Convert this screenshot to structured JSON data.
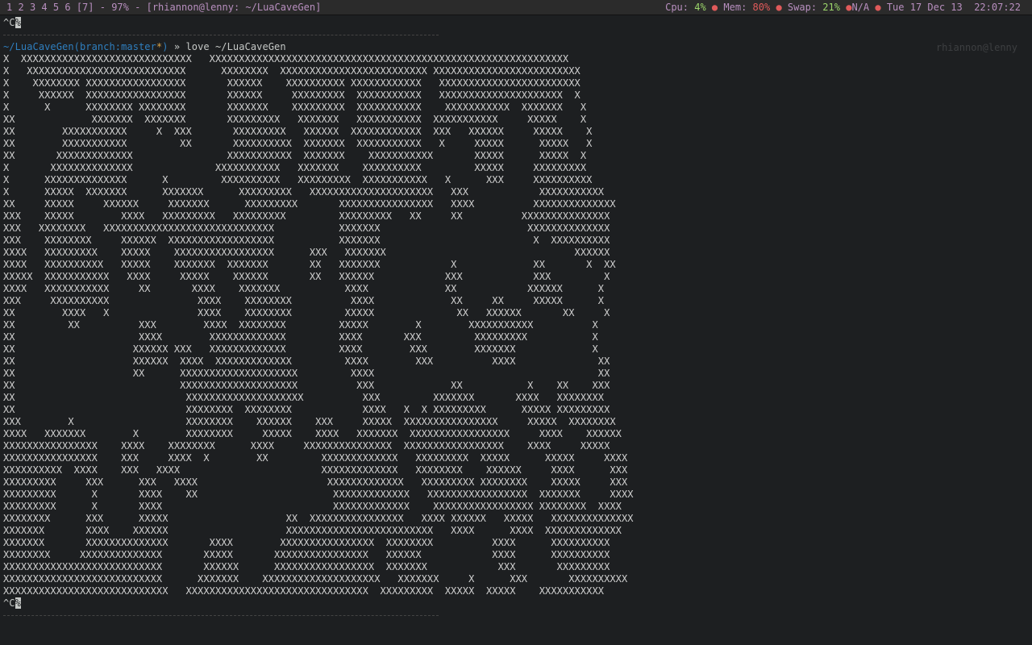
{
  "statusbar": {
    "workspaces": [
      "1",
      "2",
      "3",
      "4",
      "5",
      "6",
      "[7]"
    ],
    "zoom": "97%",
    "window_title": "[rhiannon@lenny: ~/LuaCaveGen]",
    "cpu_label": "Cpu:",
    "cpu_value": "4%",
    "mem_label": "Mem:",
    "mem_value": "80%",
    "swap_label": "Swap:",
    "swap_value": "21%",
    "battery": "N/A",
    "date": "Tue 17 Dec 13",
    "time": "22:07:22"
  },
  "terminal": {
    "interrupt_top": "^C",
    "cursor_char": "%",
    "prompt_path": "~/LuaCaveGen",
    "prompt_branch_open": "(branch:",
    "prompt_branch": "master",
    "prompt_dirty": "*",
    "prompt_branch_close": ")",
    "prompt_arrow": "»",
    "command": "love ~/LuaCaveGen",
    "hostname": "rhiannon@lenny",
    "interrupt_bottom": "^C",
    "cave_lines": [
      "X  XXXXXXXXXXXXXXXXXXXXXXXXXXXXX   XXXXXXXXXXXXXXXXXXXXXXXXXXXXXXXXXXXXXXXXXXXXXXXXXXXXXXXXXXXXX",
      "X   XXXXXXXXXXXXXXXXXXXXXXXXXXX      XXXXXXXX  XXXXXXXXXXXXXXXXXXXXXXXXX XXXXXXXXXXXXXXXXXXXXXXXXX",
      "X    XXXXXXXX XXXXXXXXXXXXXXXXX       XXXXXX    XXXXXXXXXX XXXXXXXXXXXX   XXXXXXXXXXXXXXXXXXXXXXXX",
      "X     XXXXXX  XXXXXXXXXXXXXXXXX       XXXXXX     XXXXXXXXX  XXXXXXXXXXX   XXXXXXXXXXXXXXXXXXXXX  X",
      "X      X      XXXXXXXX XXXXXXXX       XXXXXXX    XXXXXXXXX  XXXXXXXXXXX    XXXXXXXXXXX  XXXXXXX   X",
      "XX             XXXXXXX  XXXXXXX       XXXXXXXXX   XXXXXXX   XXXXXXXXXXX  XXXXXXXXXXX     XXXXX    X",
      "XX        XXXXXXXXXXX     X  XXX       XXXXXXXXX   XXXXXX  XXXXXXXXXXXX  XXX   XXXXXX     XXXXX    X",
      "XX        XXXXXXXXXXX         XX       XXXXXXXXXX  XXXXXXX  XXXXXXXXXXX   X     XXXXX      XXXXX   X",
      "XX       XXXXXXXXXXXXX                XXXXXXXXXXX  XXXXXXX    XXXXXXXXXXX       XXXXX      XXXXX  X",
      "X       XXXXXXXXXXXXXX              XXXXXXXXXXX   XXXXXXX    XXXXXXXXXX         XXXXX     XXXXXXXXX",
      "X      XXXXXXXXXXXXXX      X         XXXXXXXXXX   XXXXXXXXX  XXXXXXXXXXX   X      XXX     XXXXXXXXXX",
      "X      XXXXX  XXXXXXX      XXXXXXX      XXXXXXXXX   XXXXXXXXXXXXXXXXXXXXX   XXX            XXXXXXXXXXX",
      "XX     XXXXX     XXXXXX     XXXXXXX      XXXXXXXXX       XXXXXXXXXXXXXXXX   XXXX          XXXXXXXXXXXXXX",
      "XXX    XXXXX        XXXX   XXXXXXXXX   XXXXXXXXX         XXXXXXXXX   XX     XX          XXXXXXXXXXXXXXX",
      "XXX   XXXXXXXX   XXXXXXXXXXXXXXXXXXXXXXXXXXXXX           XXXXXXX                         XXXXXXXXXXXXXX",
      "XXX    XXXXXXXX     XXXXXX  XXXXXXXXXXXXXXXXXX           XXXXXXX                          X  XXXXXXXXXX",
      "XXXX   XXXXXXXXX    XXXXX    XXXXXXXXXXXXXXXXX      XXX   XXXXXXX                                XXXXXX",
      "XXXX   XXXXXXXXXX   XXXXX    XXXXXXX  XXXXXXX       XX   XXXXXXX            X             XX       X  XX",
      "XXXXX  XXXXXXXXXXX   XXXX     XXXXX    XXXXXX       XX   XXXXXX            XXX            XXX         X",
      "XXXX   XXXXXXXXXXX     XX       XXXX    XXXXXXX           XXXX             XX            XXXXXX      X",
      "XXX     XXXXXXXXXX               XXXX    XXXXXXXX          XXXX             XX     XX     XXXXX      X",
      "XX        XXXX   X               XXXX    XXXXXXXX         XXXXX              XX   XXXXXX       XX     X",
      "XX         XX          XXX        XXXX  XXXXXXXX         XXXXX        X        XXXXXXXXXXX          X",
      "XX                     XXXX        XXXXXXXXXXXXX         XXXX       XXX         XXXXXXXXX           X",
      "XX                    XXXXXX XXX   XXXXXXXXXXXXX         XXXX        XXX        XXXXXXX             X",
      "XX                    XXXXXX  XXXX  XXXXXXXXXXXXX         XXXX        XXX          XXXX              XX",
      "XX                    XX      XXXXXXXXXXXXXXXXXXXX         XXXX                                      XX",
      "XX                            XXXXXXXXXXXXXXXXXXXX          XXX             XX           X    XX    XXX",
      "XX                             XXXXXXXXXXXXXXXXXXXX          XXX         XXXXXXX       XXXX   XXXXXXXX",
      "XX                             XXXXXXXX  XXXXXXXX            XXXX   X  X XXXXXXXXX      XXXXX XXXXXXXXX",
      "XXX        X                   XXXXXXXX    XXXXXX    XXX     XXXXX  XXXXXXXXXXXXXXXX     XXXXX  XXXXXXXX",
      "XXXX   XXXXXXX        X        XXXXXXXX     XXXXX    XXXX   XXXXXXX  XXXXXXXXXXXXXXXXX     XXXX    XXXXXX",
      "XXXXXXXXXXXXXXXX    XXXX    XXXXXXXX      XXXX     XXXXXXXXXXXXXXX  XXXXXXXXXXXXXXXXX    XXXX     XXXXX",
      "XXXXXXXXXXXXXXXX    XXX     XXXX  X        XX         XXXXXXXXXXXXX   XXXXXXXXX  XXXXX      XXXXX     XXXX",
      "XXXXXXXXXX  XXXX    XXX   XXXX                        XXXXXXXXXXXXX   XXXXXXXX    XXXXXX     XXXX      XXX",
      "XXXXXXXXX     XXX      XXX   XXXX                      XXXXXXXXXXXXX   XXXXXXXXX XXXXXXXX    XXXXX     XXX",
      "XXXXXXXXX      X       XXXX    XX                       XXXXXXXXXXXXX   XXXXXXXXXXXXXXXXX  XXXXXXX     XXXX",
      "XXXXXXXXX      X       XXXX                             XXXXXXXXXXXXX    XXXXXXXXXXXXXXXXX XXXXXXXX  XXXX",
      "XXXXXXXX      XXX      XXXXX                    XX  XXXXXXXXXXXXXXXX   XXXX XXXXXX   XXXXX   XXXXXXXXXXXXXX",
      "XXXXXXX       XXXX    XXXXXX                    XXXXXXXXXXXXXXXXXXXXXXXXX   XXXX      XXXX  XXXXXXXXXXXXX",
      "XXXXXXX       XXXXXXXXXXXXXX       XXXX        XXXXXXXXXXXXXXXX  XXXXXXXX          XXXX      XXXXXXXXXX",
      "XXXXXXXX     XXXXXXXXXXXXXX       XXXXX       XXXXXXXXXXXXXXXX   XXXXXX            XXXX      XXXXXXXXXX",
      "XXXXXXXXXXXXXXXXXXXXXXXXXXX       XXXXXX      XXXXXXXXXXXXXXXXX  XXXXXXX            XXX       XXXXXXXXX",
      "XXXXXXXXXXXXXXXXXXXXXXXXXXX      XXXXXXX    XXXXXXXXXXXXXXXXXXXX   XXXXXXX     X      XXX       XXXXXXXXXX",
      "XXXXXXXXXXXXXXXXXXXXXXXXXXXX   XXXXXXXXXXXXXXXXXXXXXXXXXXXXXXX  XXXXXXXXX  XXXXX  XXXXX    XXXXXXXXXXX"
    ]
  }
}
